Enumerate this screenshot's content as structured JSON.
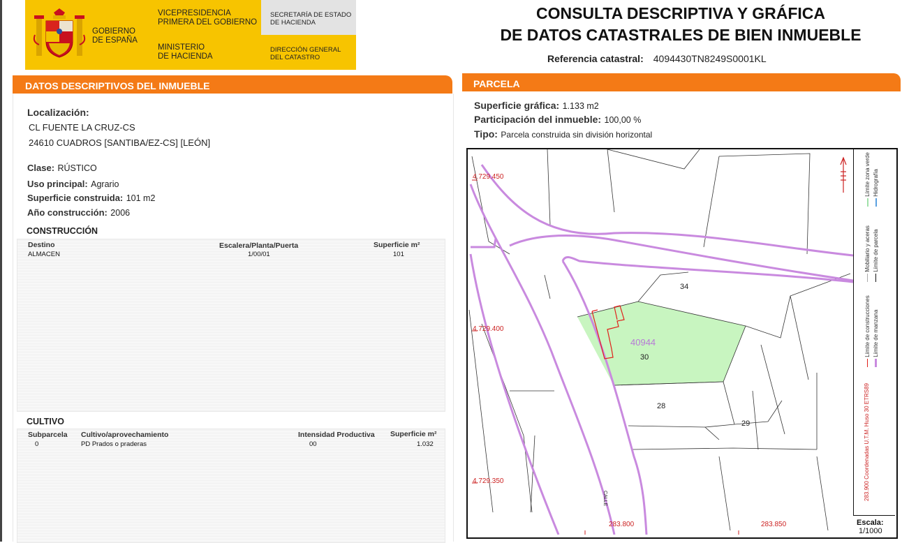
{
  "header": {
    "gov_line1": "GOBIERNO",
    "gov_line2": "DE ESPAÑA",
    "vice_line1": "VICEPRESIDENCIA",
    "vice_line2": "PRIMERA DEL GOBIERNO",
    "min_line1": "MINISTERIO",
    "min_line2": "DE HACIENDA",
    "sec_line1": "SECRETARÍA DE ESTADO",
    "sec_line2": "DE HACIENDA",
    "dir_line1": "DIRECCIÓN GENERAL",
    "dir_line2": "DEL CATASTRO",
    "title_line1": "CONSULTA DESCRIPTIVA Y GRÁFICA",
    "title_line2": "DE DATOS CATASTRALES DE BIEN INMUEBLE",
    "ref_label": "Referencia catastral:",
    "ref_value": "4094430TN8249S0001KL"
  },
  "left": {
    "section_title": "DATOS DESCRIPTIVOS DEL INMUEBLE",
    "loc_label": "Localización:",
    "loc_line1": "CL FUENTE LA CRUZ-CS",
    "loc_line2": "24610 CUADROS [SANTIBA/EZ-CS] [LEÓN]",
    "clase_label": "Clase:",
    "clase_value": "RÚSTICO",
    "uso_label": "Uso principal:",
    "uso_value": "Agrario",
    "sup_label": "Superficie construida:",
    "sup_value": "101 m2",
    "anio_label": "Año construcción:",
    "anio_value": "2006",
    "construccion": {
      "title": "CONSTRUCCIÓN",
      "col_destino": "Destino",
      "col_escalera": "Escalera/Planta/Puerta",
      "col_superficie": "Superficie m²",
      "row_destino": "ALMACEN",
      "row_escalera": "1/00/01",
      "row_superficie": "101"
    },
    "cultivo": {
      "title": "CULTIVO",
      "col_subparcela": "Subparcela",
      "col_cultivo": "Cultivo/aprovechamiento",
      "col_intensidad": "Intensidad Productiva",
      "col_superficie": "Superficie m²",
      "row_subparcela": "0",
      "row_cultivo": "PD Prados o praderas",
      "row_intensidad": "00",
      "row_superficie": "1.032"
    }
  },
  "right": {
    "section_title": "PARCELA",
    "sup_label": "Superficie gráfica:",
    "sup_value": "1.133 m2",
    "part_label": "Participación del inmueble:",
    "part_value": "100,00 %",
    "tipo_label": "Tipo:",
    "tipo_value": "Parcela construida sin división horizontal"
  },
  "map": {
    "y_coord_1": "4.729.450",
    "y_coord_2": "4.729.400",
    "y_coord_3": "4.729.350",
    "x_coord_1": "283.800",
    "x_coord_2": "283.850",
    "parcel_code": "40944",
    "parcel_30": "30",
    "parcel_34": "34",
    "parcel_28": "28",
    "parcel_29": "29",
    "street_label": "CALLE",
    "legend_hidrografia": "Hidrografía",
    "legend_zona_verde": "Límite zona verde",
    "legend_parcela": "Límite de parcela",
    "legend_mobiliario": "Mobiliario y aceras",
    "legend_manzana": "Límite de manzana",
    "legend_construcciones": "Límite de construcciones",
    "coord_note": "283.900 Coordenadas U.T.M. Huso 30 ETRS89",
    "scale_label": "Escala:",
    "scale_value": "1/1000",
    "colors": {
      "manzana": "#c98adf",
      "parcel_fill": "#c8f5c0",
      "construccion": "#e0201a",
      "coord_text": "#cc2222",
      "parcel_code": "#b77ad6"
    }
  }
}
